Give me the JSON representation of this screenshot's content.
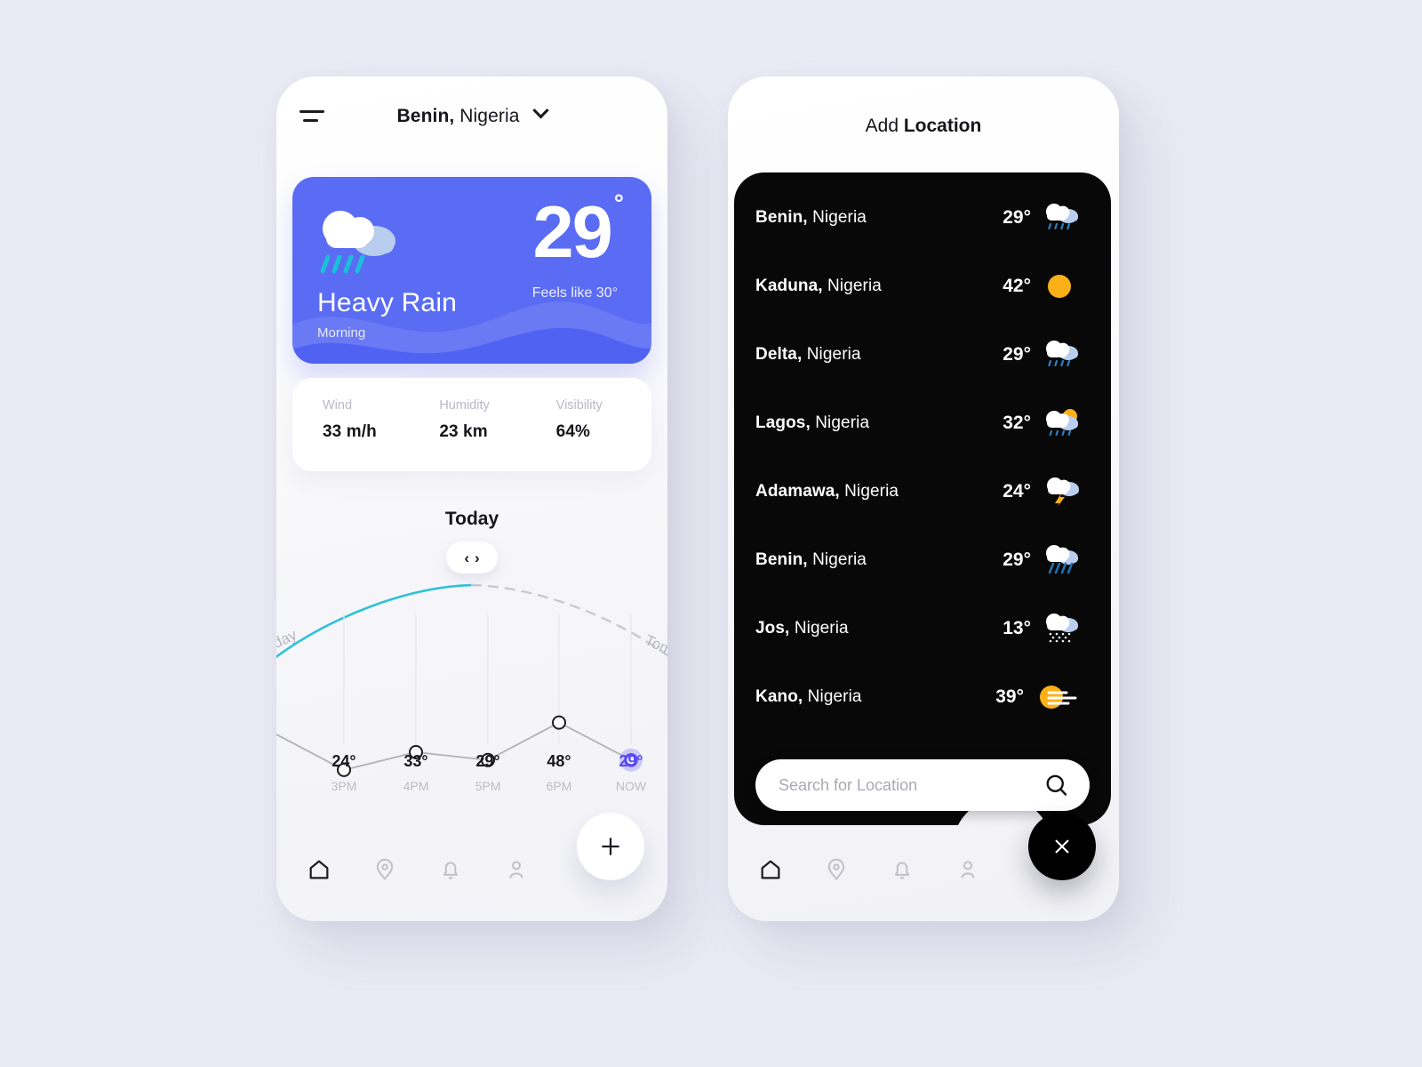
{
  "background_color": "#eaeaf4",
  "accent_color": "#5a6cf3",
  "accent_indigo": "#5a4cf0",
  "home": {
    "menu_icon": "hamburger-icon",
    "location": {
      "city": "Benin,",
      "country": "Nigeria",
      "chevron": "chevron-down-icon"
    },
    "current": {
      "temperature": "29",
      "degree": "°",
      "feels_like": "Feels like 30°",
      "condition": "Heavy Rain",
      "time_of_day": "Morning",
      "icon": "cloud-rain-icon",
      "card_color": "#5a6cf3"
    },
    "stats": [
      {
        "label": "Wind",
        "value": "33 m/h",
        "name": "wind"
      },
      {
        "label": "Humidity",
        "value": "23 km",
        "name": "humidity"
      },
      {
        "label": "Visibility",
        "value": "64%",
        "name": "visibility"
      }
    ],
    "forecast": {
      "title": "Today",
      "prev_label": "day",
      "next_label": "Tom",
      "pill_prev": "‹",
      "pill_next": "›"
    },
    "nav": [
      {
        "name": "home",
        "icon": "home-icon",
        "active": true
      },
      {
        "name": "location",
        "icon": "map-pin-icon",
        "active": false
      },
      {
        "name": "alerts",
        "icon": "bell-icon",
        "active": false
      },
      {
        "name": "profile",
        "icon": "user-icon",
        "active": false
      }
    ],
    "fab": {
      "icon": "plus-icon",
      "label": "+"
    }
  },
  "chart_data": {
    "type": "line",
    "title": "Today",
    "categories": [
      "3PM",
      "4PM",
      "5PM",
      "6PM",
      "NOW"
    ],
    "values": [
      24,
      33,
      29,
      48,
      29
    ],
    "value_labels": [
      "24°",
      "33°",
      "29°",
      "48°",
      "29°"
    ],
    "xlabel": "",
    "ylabel": "",
    "ylim": [
      10,
      55
    ],
    "grid": "vertical",
    "legend": "none",
    "highlight_index": 4,
    "highlight_color": "#5a4cf0",
    "line_color": "#b4b4bd",
    "arc": {
      "past_color": "#2fc2d8",
      "future_style": "dashed",
      "future_color": "#c9c9d2"
    }
  },
  "add_location": {
    "header_part1": "Add ",
    "header_part2": "Location",
    "search": {
      "placeholder": "Search for Location",
      "value": "",
      "icon": "search-icon"
    },
    "close_button": {
      "icon": "close-icon",
      "label": "×"
    },
    "items": [
      {
        "city": "Benin,",
        "country": "Nigeria",
        "temp": "29°",
        "icon": "cloud-rain-icon"
      },
      {
        "city": "Kaduna,",
        "country": "Nigeria",
        "temp": "42°",
        "icon": "sun-icon"
      },
      {
        "city": "Delta,",
        "country": "Nigeria",
        "temp": "29°",
        "icon": "cloud-rain-icon"
      },
      {
        "city": "Lagos,",
        "country": "Nigeria",
        "temp": "32°",
        "icon": "sun-cloud-rain-icon"
      },
      {
        "city": "Adamawa,",
        "country": "Nigeria",
        "temp": "24°",
        "icon": "cloud-lightning-icon"
      },
      {
        "city": "Benin,",
        "country": "Nigeria",
        "temp": "29°",
        "icon": "cloud-heavy-rain-icon"
      },
      {
        "city": "Jos,",
        "country": "Nigeria",
        "temp": "13°",
        "icon": "cloud-snow-icon"
      },
      {
        "city": "Kano,",
        "country": "Nigeria",
        "temp": "39°",
        "icon": "sun-haze-icon"
      }
    ],
    "nav": [
      {
        "name": "home",
        "icon": "home-icon",
        "active": true
      },
      {
        "name": "location",
        "icon": "map-pin-icon",
        "active": false
      },
      {
        "name": "alerts",
        "icon": "bell-icon",
        "active": false
      },
      {
        "name": "profile",
        "icon": "user-icon",
        "active": false
      }
    ]
  }
}
